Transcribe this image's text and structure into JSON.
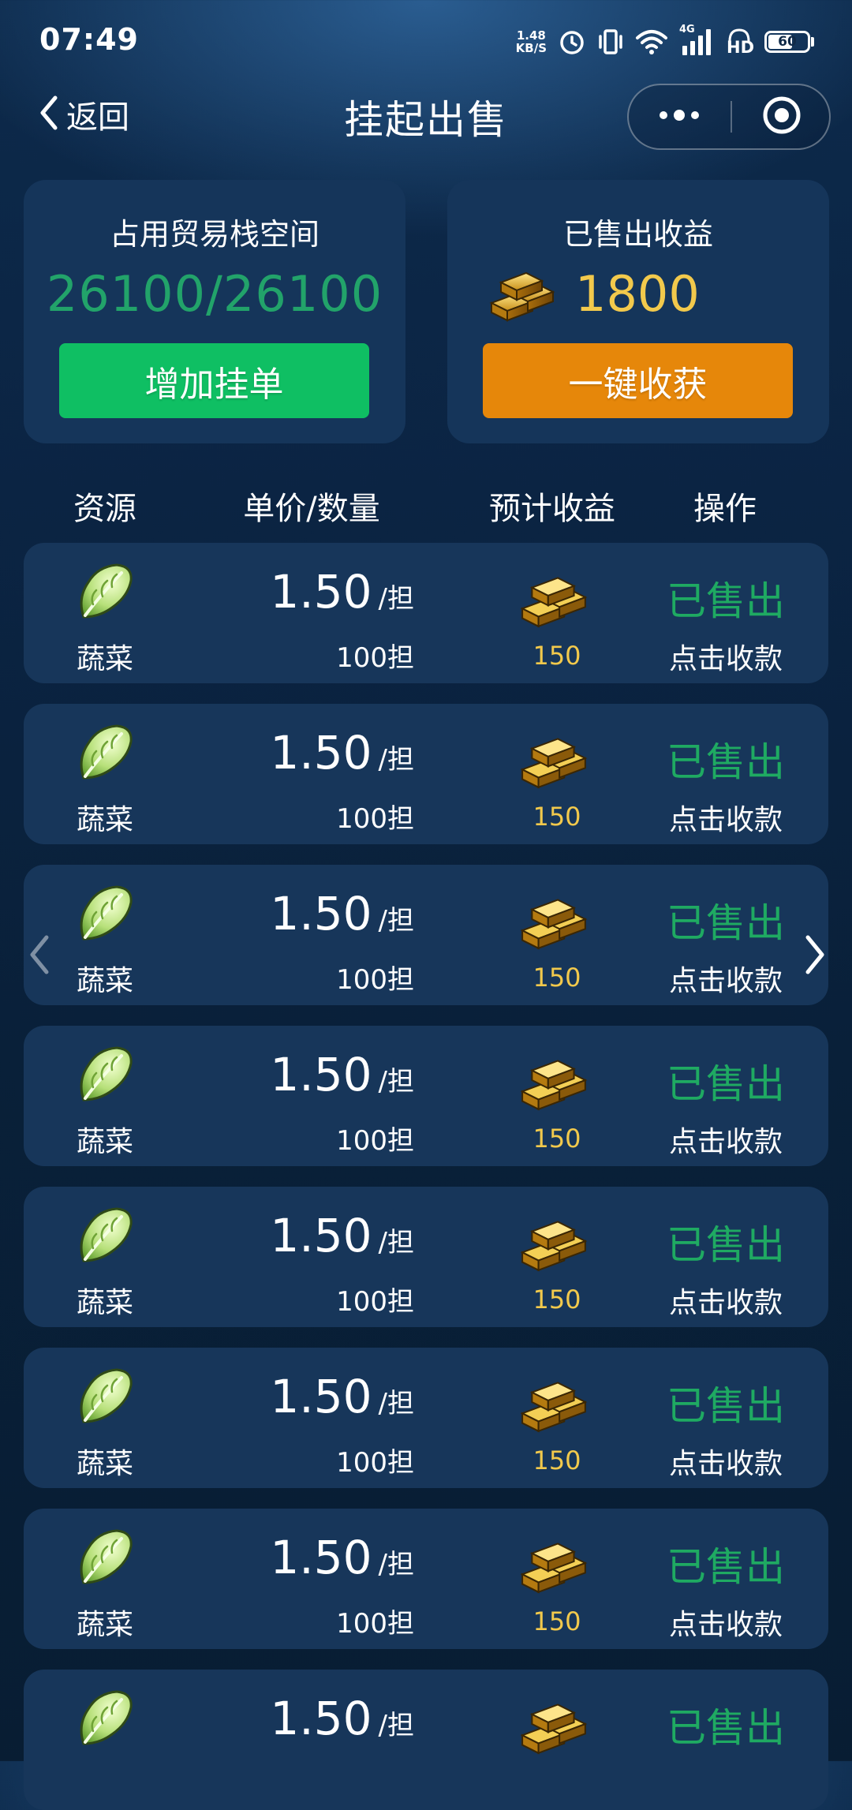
{
  "status_bar": {
    "time": "07:49",
    "net_speed_value": "1.48",
    "net_speed_unit": "KB/S",
    "network_label": "4G",
    "hd_label": "HD",
    "battery_level": "60"
  },
  "nav": {
    "back_label": "返回",
    "title": "挂起出售"
  },
  "summary": {
    "storage_label": "占用贸易栈空间",
    "storage_value": "26100/26100",
    "add_button": "增加挂单",
    "income_label": "已售出收益",
    "income_value": "1800",
    "harvest_button": "一键收获"
  },
  "table": {
    "headers": [
      "资源",
      "单价/数量",
      "预计收益",
      "操作"
    ],
    "rows": [
      {
        "resource": "蔬菜",
        "price": "1.50",
        "unit": "/担",
        "quantity": "100担",
        "estimate": "150",
        "status": "已售出",
        "action": "点击收款"
      },
      {
        "resource": "蔬菜",
        "price": "1.50",
        "unit": "/担",
        "quantity": "100担",
        "estimate": "150",
        "status": "已售出",
        "action": "点击收款"
      },
      {
        "resource": "蔬菜",
        "price": "1.50",
        "unit": "/担",
        "quantity": "100担",
        "estimate": "150",
        "status": "已售出",
        "action": "点击收款"
      },
      {
        "resource": "蔬菜",
        "price": "1.50",
        "unit": "/担",
        "quantity": "100担",
        "estimate": "150",
        "status": "已售出",
        "action": "点击收款"
      },
      {
        "resource": "蔬菜",
        "price": "1.50",
        "unit": "/担",
        "quantity": "100担",
        "estimate": "150",
        "status": "已售出",
        "action": "点击收款"
      },
      {
        "resource": "蔬菜",
        "price": "1.50",
        "unit": "/担",
        "quantity": "100担",
        "estimate": "150",
        "status": "已售出",
        "action": "点击收款"
      },
      {
        "resource": "蔬菜",
        "price": "1.50",
        "unit": "/担",
        "quantity": "100担",
        "estimate": "150",
        "status": "已售出",
        "action": "点击收款"
      },
      {
        "resource": "",
        "price": "1.50",
        "unit": "/担",
        "quantity": "",
        "estimate": "",
        "status": "已售出",
        "action": ""
      }
    ]
  },
  "icons": {
    "back": "chevron-left-icon",
    "more": "more-dots-icon",
    "close": "target-circle-icon",
    "resource": "cabbage-icon",
    "currency": "gold-bars-icon",
    "prev": "chevron-left-icon",
    "next": "chevron-right-icon"
  },
  "colors": {
    "background": "#0b2443",
    "card": "#15355a",
    "row": "#17365a",
    "storage_green": "#22a36a",
    "sold_green": "#1faa62",
    "gold": "#f2c94c",
    "add_button": "#0fbf63",
    "harvest_button": "#e6870a"
  }
}
